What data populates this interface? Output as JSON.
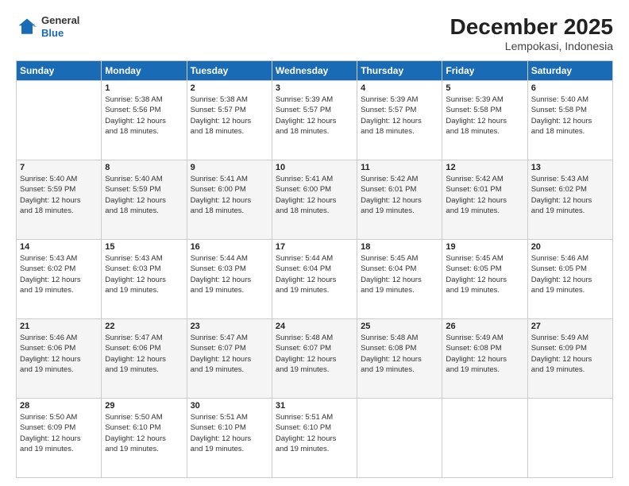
{
  "logo": {
    "general": "General",
    "blue": "Blue"
  },
  "title": "December 2025",
  "subtitle": "Lempokasi, Indonesia",
  "days_header": [
    "Sunday",
    "Monday",
    "Tuesday",
    "Wednesday",
    "Thursday",
    "Friday",
    "Saturday"
  ],
  "weeks": [
    [
      {
        "day": "",
        "info": ""
      },
      {
        "day": "1",
        "info": "Sunrise: 5:38 AM\nSunset: 5:56 PM\nDaylight: 12 hours\nand 18 minutes."
      },
      {
        "day": "2",
        "info": "Sunrise: 5:38 AM\nSunset: 5:57 PM\nDaylight: 12 hours\nand 18 minutes."
      },
      {
        "day": "3",
        "info": "Sunrise: 5:39 AM\nSunset: 5:57 PM\nDaylight: 12 hours\nand 18 minutes."
      },
      {
        "day": "4",
        "info": "Sunrise: 5:39 AM\nSunset: 5:57 PM\nDaylight: 12 hours\nand 18 minutes."
      },
      {
        "day": "5",
        "info": "Sunrise: 5:39 AM\nSunset: 5:58 PM\nDaylight: 12 hours\nand 18 minutes."
      },
      {
        "day": "6",
        "info": "Sunrise: 5:40 AM\nSunset: 5:58 PM\nDaylight: 12 hours\nand 18 minutes."
      }
    ],
    [
      {
        "day": "7",
        "info": "Sunrise: 5:40 AM\nSunset: 5:59 PM\nDaylight: 12 hours\nand 18 minutes."
      },
      {
        "day": "8",
        "info": "Sunrise: 5:40 AM\nSunset: 5:59 PM\nDaylight: 12 hours\nand 18 minutes."
      },
      {
        "day": "9",
        "info": "Sunrise: 5:41 AM\nSunset: 6:00 PM\nDaylight: 12 hours\nand 18 minutes."
      },
      {
        "day": "10",
        "info": "Sunrise: 5:41 AM\nSunset: 6:00 PM\nDaylight: 12 hours\nand 18 minutes."
      },
      {
        "day": "11",
        "info": "Sunrise: 5:42 AM\nSunset: 6:01 PM\nDaylight: 12 hours\nand 19 minutes."
      },
      {
        "day": "12",
        "info": "Sunrise: 5:42 AM\nSunset: 6:01 PM\nDaylight: 12 hours\nand 19 minutes."
      },
      {
        "day": "13",
        "info": "Sunrise: 5:43 AM\nSunset: 6:02 PM\nDaylight: 12 hours\nand 19 minutes."
      }
    ],
    [
      {
        "day": "14",
        "info": "Sunrise: 5:43 AM\nSunset: 6:02 PM\nDaylight: 12 hours\nand 19 minutes."
      },
      {
        "day": "15",
        "info": "Sunrise: 5:43 AM\nSunset: 6:03 PM\nDaylight: 12 hours\nand 19 minutes."
      },
      {
        "day": "16",
        "info": "Sunrise: 5:44 AM\nSunset: 6:03 PM\nDaylight: 12 hours\nand 19 minutes."
      },
      {
        "day": "17",
        "info": "Sunrise: 5:44 AM\nSunset: 6:04 PM\nDaylight: 12 hours\nand 19 minutes."
      },
      {
        "day": "18",
        "info": "Sunrise: 5:45 AM\nSunset: 6:04 PM\nDaylight: 12 hours\nand 19 minutes."
      },
      {
        "day": "19",
        "info": "Sunrise: 5:45 AM\nSunset: 6:05 PM\nDaylight: 12 hours\nand 19 minutes."
      },
      {
        "day": "20",
        "info": "Sunrise: 5:46 AM\nSunset: 6:05 PM\nDaylight: 12 hours\nand 19 minutes."
      }
    ],
    [
      {
        "day": "21",
        "info": "Sunrise: 5:46 AM\nSunset: 6:06 PM\nDaylight: 12 hours\nand 19 minutes."
      },
      {
        "day": "22",
        "info": "Sunrise: 5:47 AM\nSunset: 6:06 PM\nDaylight: 12 hours\nand 19 minutes."
      },
      {
        "day": "23",
        "info": "Sunrise: 5:47 AM\nSunset: 6:07 PM\nDaylight: 12 hours\nand 19 minutes."
      },
      {
        "day": "24",
        "info": "Sunrise: 5:48 AM\nSunset: 6:07 PM\nDaylight: 12 hours\nand 19 minutes."
      },
      {
        "day": "25",
        "info": "Sunrise: 5:48 AM\nSunset: 6:08 PM\nDaylight: 12 hours\nand 19 minutes."
      },
      {
        "day": "26",
        "info": "Sunrise: 5:49 AM\nSunset: 6:08 PM\nDaylight: 12 hours\nand 19 minutes."
      },
      {
        "day": "27",
        "info": "Sunrise: 5:49 AM\nSunset: 6:09 PM\nDaylight: 12 hours\nand 19 minutes."
      }
    ],
    [
      {
        "day": "28",
        "info": "Sunrise: 5:50 AM\nSunset: 6:09 PM\nDaylight: 12 hours\nand 19 minutes."
      },
      {
        "day": "29",
        "info": "Sunrise: 5:50 AM\nSunset: 6:10 PM\nDaylight: 12 hours\nand 19 minutes."
      },
      {
        "day": "30",
        "info": "Sunrise: 5:51 AM\nSunset: 6:10 PM\nDaylight: 12 hours\nand 19 minutes."
      },
      {
        "day": "31",
        "info": "Sunrise: 5:51 AM\nSunset: 6:10 PM\nDaylight: 12 hours\nand 19 minutes."
      },
      {
        "day": "",
        "info": ""
      },
      {
        "day": "",
        "info": ""
      },
      {
        "day": "",
        "info": ""
      }
    ]
  ]
}
